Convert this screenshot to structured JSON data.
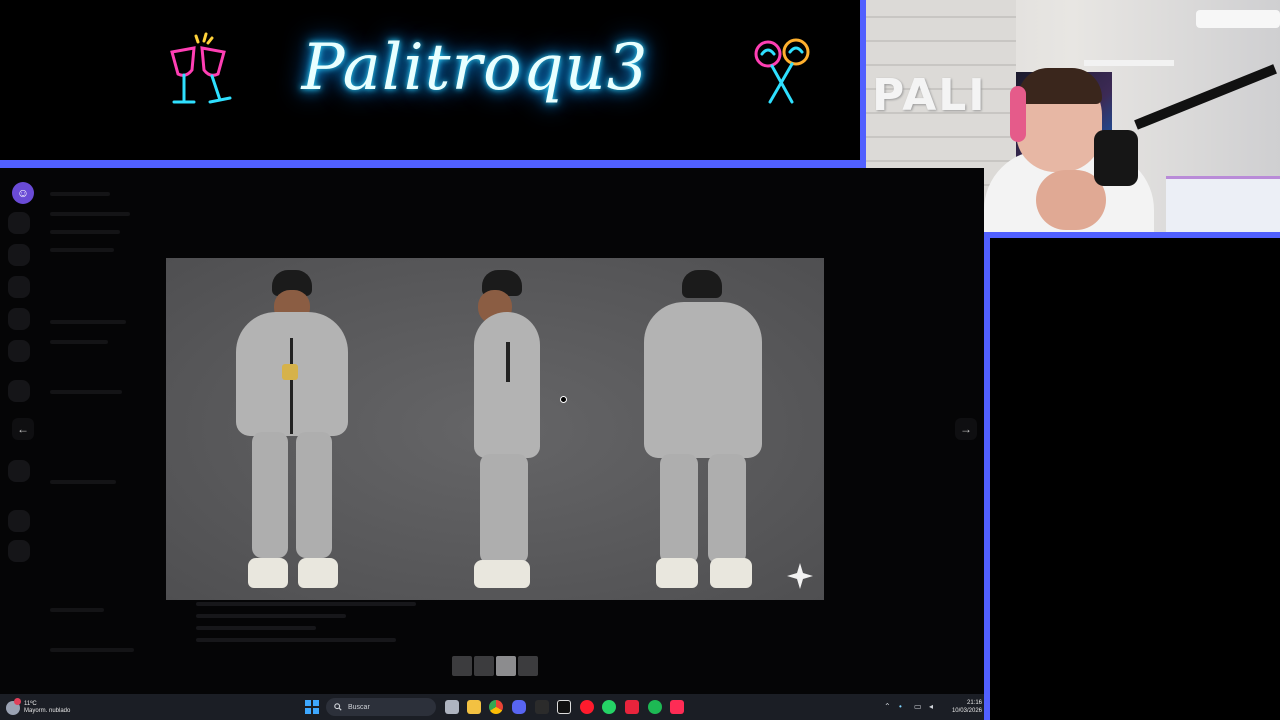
{
  "banner": {
    "logo_text": "Palitroqu3"
  },
  "webcam": {
    "sign_text": "PALI"
  },
  "taskbar": {
    "weather": {
      "temp": "11ºC",
      "condition": "Mayorm. nublado",
      "badge_count": "1"
    },
    "search_placeholder": "Buscar",
    "apps": [
      "task-view",
      "file-explorer",
      "chrome",
      "discord",
      "terminal",
      "capcut",
      "opera",
      "whatsapp",
      "acrobat",
      "spotify",
      "tiktok"
    ],
    "clock": {
      "time": "21:16",
      "date": "10/03/2026"
    }
  },
  "lightbox": {
    "image_alt": "Three views (front, side, back) of a 3D character in a grey tracksuit",
    "thumbnails": [
      false,
      false,
      true,
      false
    ],
    "prev_symbol": "←",
    "next_symbol": "→"
  },
  "colors": {
    "frame": "#5160ff",
    "neon": "#2fd7ff",
    "taskbar": "#1b1e25"
  }
}
